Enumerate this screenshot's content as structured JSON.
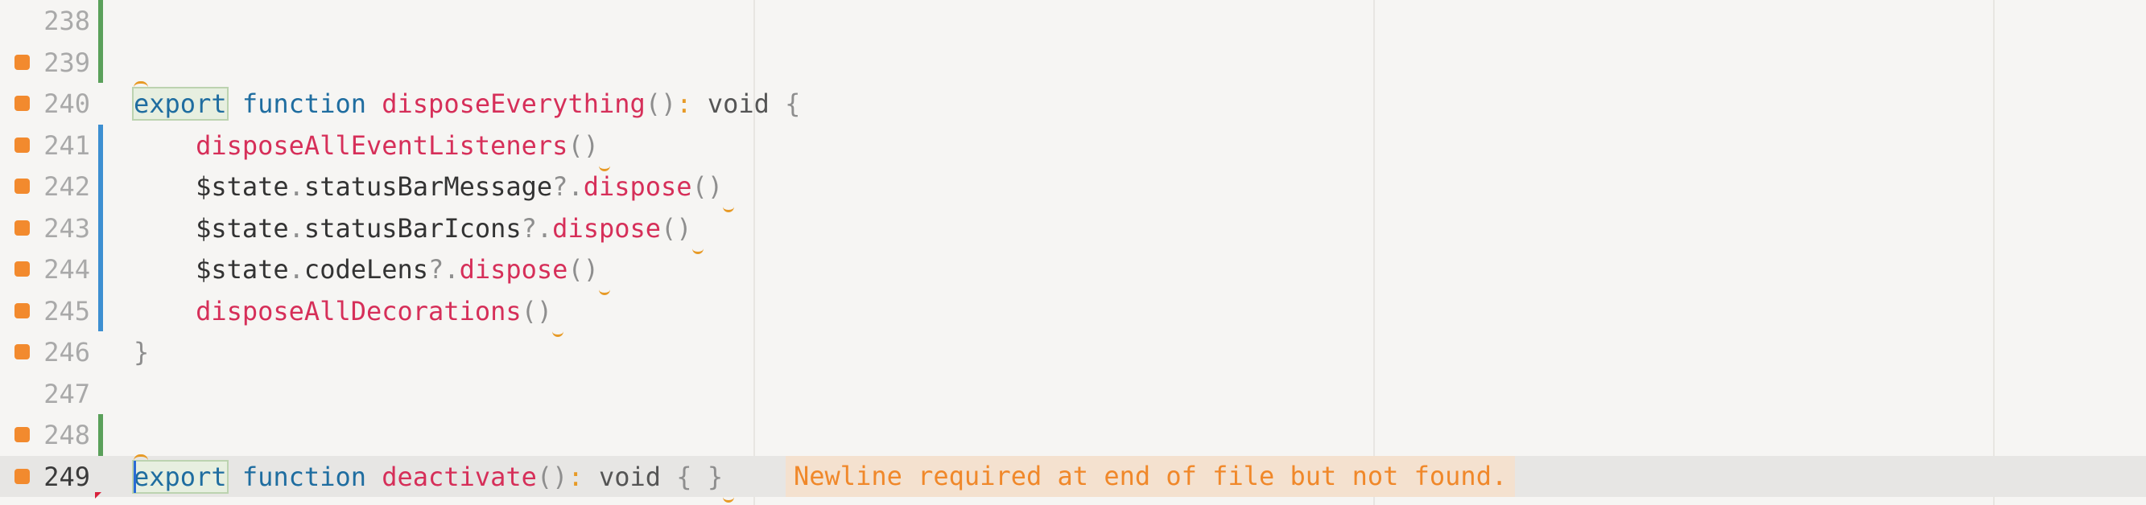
{
  "lines": [
    {
      "num": "238",
      "marker": false,
      "bar": "green",
      "code": ""
    },
    {
      "num": "239",
      "marker": true,
      "bar": "green",
      "code": ""
    },
    {
      "num": "240",
      "marker": true,
      "bar": "",
      "code": "export function disposeEverything(): void {"
    },
    {
      "num": "241",
      "marker": true,
      "bar": "blue",
      "code": "    disposeAllEventListeners()"
    },
    {
      "num": "242",
      "marker": true,
      "bar": "blue",
      "code": "    $state.statusBarMessage?.dispose()"
    },
    {
      "num": "243",
      "marker": true,
      "bar": "blue",
      "code": "    $state.statusBarIcons?.dispose()"
    },
    {
      "num": "244",
      "marker": true,
      "bar": "blue",
      "code": "    $state.codeLens?.dispose()"
    },
    {
      "num": "245",
      "marker": true,
      "bar": "blue",
      "code": "    disposeAllDecorations()"
    },
    {
      "num": "246",
      "marker": true,
      "bar": "",
      "code": "}"
    },
    {
      "num": "247",
      "marker": false,
      "bar": "",
      "code": ""
    },
    {
      "num": "248",
      "marker": true,
      "bar": "green",
      "code": ""
    },
    {
      "num": "249",
      "marker": true,
      "bar": "",
      "code": "export function deactivate(): void { }",
      "current": true
    }
  ],
  "diagnostic": "Newline required at end of file but not found.",
  "colors": {
    "keyword": "#1f6da0",
    "function": "#d62f59",
    "marker": "#f28a2e",
    "diagnostic_text": "#f0882a",
    "diagnostic_bg": "#f4e1cf",
    "added_bar": "#5aa05a",
    "modified_bar": "#3d8fd1"
  }
}
